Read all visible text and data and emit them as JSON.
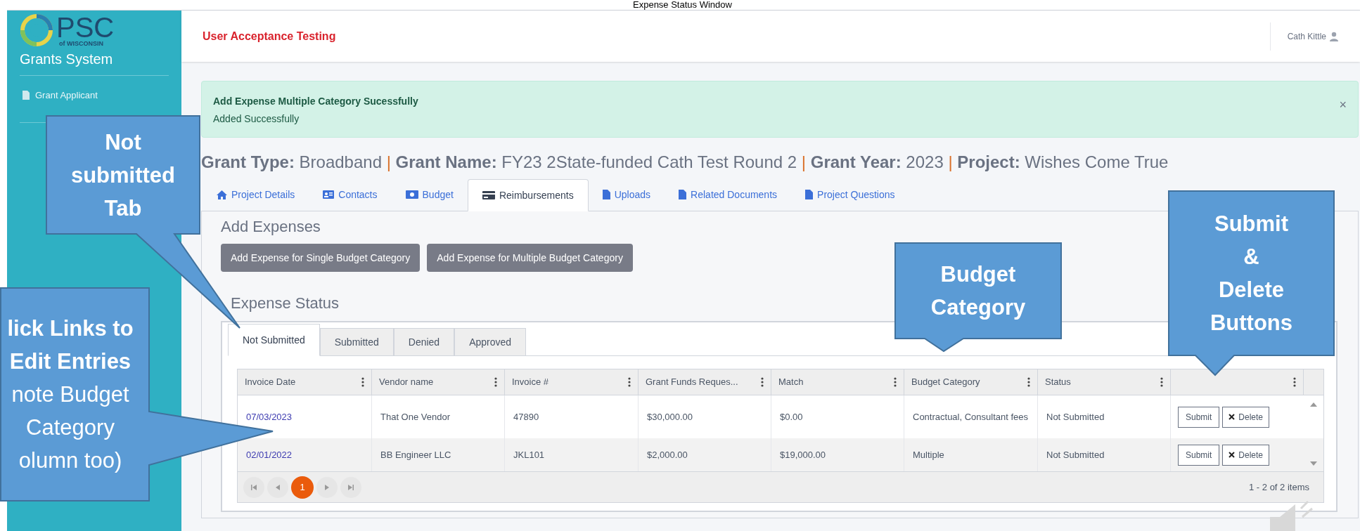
{
  "slide_title": "Expense Status Window",
  "sidebar": {
    "logo_text": "PSC",
    "logo_subtext": "of WISCONSIN",
    "system_name": "Grants System",
    "items": [
      {
        "label": "Grant Applicant",
        "selected": false
      }
    ]
  },
  "topbar": {
    "environment": "User Acceptance Testing",
    "user": "Cath Kittle"
  },
  "alert": {
    "title": "Add Expense Multiple Category Sucessfully",
    "message": "Added Successfully",
    "close": "×"
  },
  "grant_header": {
    "separator": "|",
    "fields": [
      {
        "label": "Grant Type:",
        "value": "Broadband"
      },
      {
        "label": "Grant Name:",
        "value": "FY23 2State-funded Cath Test Round 2"
      },
      {
        "label": "Grant Year:",
        "value": "2023"
      },
      {
        "label": "Project:",
        "value": "Wishes Come True"
      }
    ]
  },
  "tabs": [
    {
      "label": "Project Details",
      "selected": false
    },
    {
      "label": "Contacts",
      "selected": false
    },
    {
      "label": "Budget",
      "selected": false
    },
    {
      "label": "Reimbursements",
      "selected": true
    },
    {
      "label": "Uploads",
      "selected": false
    },
    {
      "label": "Related Documents",
      "selected": false
    },
    {
      "label": "Project Questions",
      "selected": false
    }
  ],
  "add_expenses": {
    "heading": "Add Expenses",
    "buttons": [
      "Add Expense for Single Budget Category",
      "Add Expense for Multiple Budget Category"
    ]
  },
  "expense_status": {
    "heading": "Expense Status",
    "tabs": [
      {
        "label": "Not Submitted",
        "selected": true
      },
      {
        "label": "Submitted",
        "selected": false
      },
      {
        "label": "Denied",
        "selected": false
      },
      {
        "label": "Approved",
        "selected": false
      }
    ],
    "table": {
      "columns": [
        "Invoice Date",
        "Vendor name",
        "Invoice #",
        "Grant Funds Reques...",
        "Match",
        "Budget Category",
        "Status",
        ""
      ],
      "rows": [
        {
          "cells": [
            "07/03/2023",
            "That One Vendor",
            "47890",
            "$30,000.00",
            "$0.00",
            "Contractual, Consultant fees",
            "Not Submitted"
          ],
          "actions": [
            "Submit",
            "Delete"
          ]
        },
        {
          "cells": [
            "02/01/2022",
            "BB Engineer LLC",
            "JKL101",
            "$2,000.00",
            "$19,000.00",
            "Multiple",
            "Not Submitted"
          ],
          "actions": [
            "Submit",
            "Delete"
          ]
        }
      ]
    },
    "pager": {
      "pages": [
        {
          "label": "1",
          "selected": true
        }
      ],
      "summary": "1 - 2 of 2 items"
    }
  },
  "callouts": [
    {
      "lines": [
        {
          "text": "Not",
          "bold": true
        },
        {
          "text": "submitted",
          "bold": true
        },
        {
          "text": "Tab",
          "bold": true
        }
      ]
    },
    {
      "lines": [
        {
          "text": "lick Links to",
          "bold": true
        },
        {
          "text": "Edit Entries",
          "bold": true
        },
        {
          "text": "note Budget",
          "bold": false
        },
        {
          "text": "Category",
          "bold": false
        },
        {
          "text": "olumn too)",
          "bold": false
        }
      ]
    },
    {
      "lines": [
        {
          "text": "Budget",
          "bold": true
        },
        {
          "text": "Category",
          "bold": true
        }
      ]
    },
    {
      "lines": [
        {
          "text": "Submit",
          "bold": true
        },
        {
          "text": "&",
          "bold": true
        },
        {
          "text": "Delete",
          "bold": true
        },
        {
          "text": "Buttons",
          "bold": true
        }
      ]
    }
  ]
}
